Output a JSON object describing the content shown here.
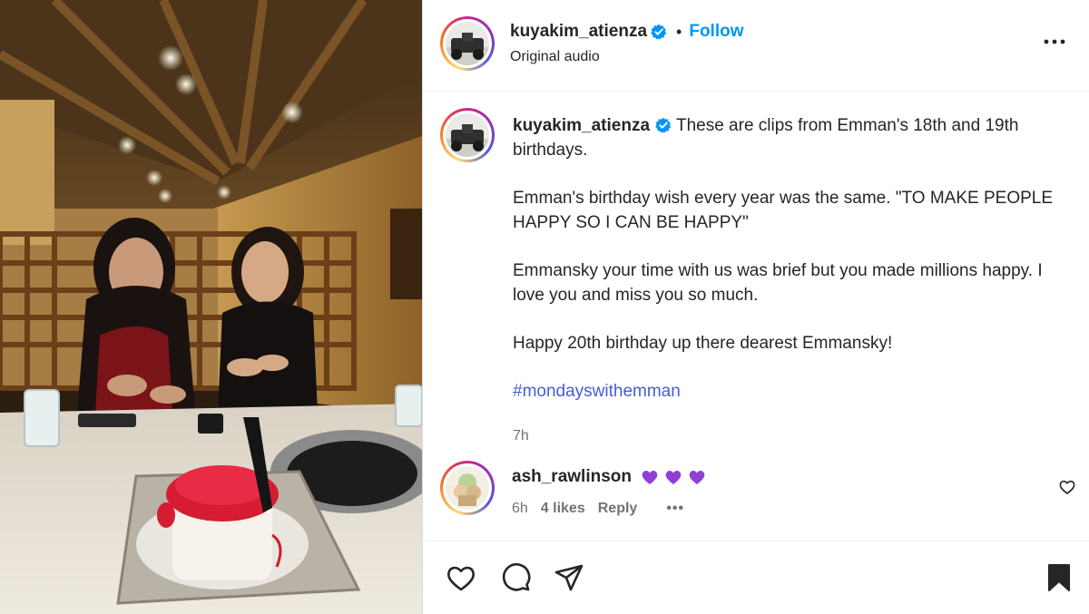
{
  "post": {
    "author": "kuyakim_atienza",
    "follow_label": "Follow",
    "separator": "•",
    "audio": "Original audio"
  },
  "caption": {
    "author": "kuyakim_atienza",
    "line1": "These are clips from Emman's 18th and 19th birthdays.",
    "para2": "Emman's birthday wish every year was the same. \"TO MAKE PEOPLE HAPPY SO I CAN BE HAPPY\"",
    "para3": "Emmansky your time with us was brief but you made millions happy. I love you and miss you so much.",
    "para4": "Happy 20th birthday up there dearest Emmansky!",
    "hashtag": "#mondayswithemman",
    "time": "7h"
  },
  "comment": {
    "author": "ash_rawlinson",
    "emoji": [
      "purple-heart",
      "purple-heart",
      "purple-heart"
    ],
    "time": "6h",
    "likes": "4 likes",
    "reply_label": "Reply",
    "more_label": "•••"
  },
  "icons": {
    "verified": "verified-badge-icon",
    "more": "more-options-icon",
    "like": "heart-outline-icon",
    "comment": "comment-bubble-icon",
    "share": "paper-plane-icon",
    "save": "bookmark-filled-icon"
  },
  "colors": {
    "link_blue": "#0095f6",
    "hashtag": "#4a5bd8",
    "verified": "#0095f6",
    "emoji_purple": "#8f3fd6",
    "muted": "#737373",
    "text": "#262626"
  }
}
